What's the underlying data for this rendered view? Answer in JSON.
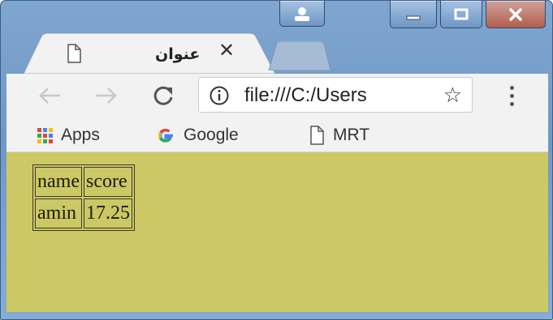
{
  "window": {
    "caption_buttons": [
      "user-icon",
      "minimize-icon",
      "maximize-icon",
      "close-icon"
    ]
  },
  "tab": {
    "title": "عنوان",
    "icon": "document-icon",
    "close_glyph": "✕"
  },
  "toolbar": {
    "back_icon": "arrow-left-icon",
    "forward_icon": "arrow-right-icon",
    "reload_icon": "reload-icon",
    "url": "file:///C:/Users",
    "info_icon": "info-circle-icon",
    "star_glyph": "☆",
    "menu_icon": "three-dots-vertical-icon"
  },
  "bookmarks": [
    {
      "label": "Apps",
      "icon": "apps-grid-icon"
    },
    {
      "label": "Google",
      "icon": "google-g-icon"
    },
    {
      "label": "MRT",
      "icon": "document-icon"
    }
  ],
  "page": {
    "background_color": "#cbc865",
    "table": {
      "rows": [
        [
          "name",
          "score"
        ],
        [
          "amin",
          "17.25"
        ]
      ]
    }
  },
  "colors": {
    "frame": "#7fa6cf",
    "close_button": "#b35e4c",
    "google_blue": "#4285f4"
  }
}
